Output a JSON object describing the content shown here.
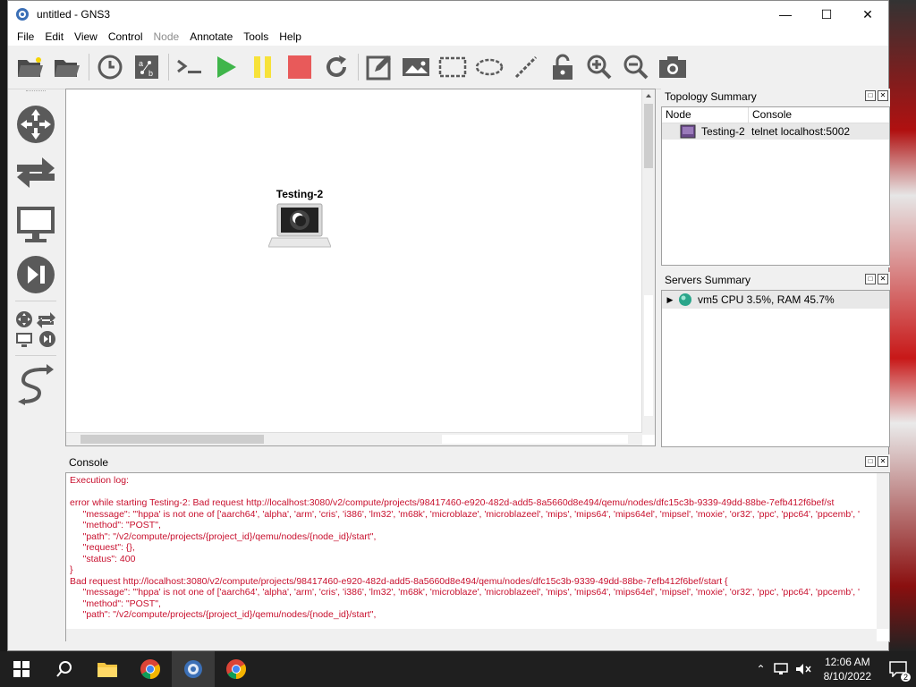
{
  "window": {
    "title": "untitled - GNS3",
    "minimize": "—",
    "maximize": "☐",
    "close": "✕"
  },
  "menu": [
    "File",
    "Edit",
    "View",
    "Control",
    "Node",
    "Annotate",
    "Tools",
    "Help"
  ],
  "menu_disabled": [
    "Node"
  ],
  "toolbar_icons": [
    "open-project-icon",
    "open-folder-icon",
    "snapshot-clock-icon",
    "show-interface-labels-icon",
    "console-all-icon",
    "start-all-icon",
    "suspend-all-icon",
    "stop-all-icon",
    "reload-all-icon",
    "add-note-icon",
    "insert-image-icon",
    "draw-rectangle-icon",
    "draw-ellipse-icon",
    "draw-line-icon",
    "lock-icon",
    "zoom-in-icon",
    "zoom-out-icon",
    "screenshot-icon"
  ],
  "left_dock_icons": [
    "routers-icon",
    "switches-icon",
    "end-devices-icon",
    "security-devices-icon",
    "all-devices-icon",
    "add-link-icon"
  ],
  "node": {
    "label": "Testing-2"
  },
  "topology": {
    "title": "Topology Summary",
    "columns": [
      "Node",
      "Console"
    ],
    "rows": [
      {
        "node": "Testing-2",
        "console": "telnet localhost:5002"
      }
    ]
  },
  "servers": {
    "title": "Servers Summary",
    "rows": [
      {
        "name": "vm5 CPU 3.5%, RAM 45.7%"
      }
    ]
  },
  "console": {
    "title": "Console",
    "lines": [
      "Execution log:",
      "",
      "error while starting Testing-2: Bad request http://localhost:3080/v2/compute/projects/98417460-e920-482d-add5-8a5660d8e494/qemu/nodes/dfc15c3b-9339-49dd-88be-7efb412f6bef/st",
      "     \"message\": \"'hppa' is not one of ['aarch64', 'alpha', 'arm', 'cris', 'i386', 'lm32', 'm68k', 'microblaze', 'microblazeel', 'mips', 'mips64', 'mips64el', 'mipsel', 'moxie', 'or32', 'ppc', 'ppc64', 'ppcemb', '",
      "     \"method\": \"POST\",",
      "     \"path\": \"/v2/compute/projects/{project_id}/qemu/nodes/{node_id}/start\",",
      "     \"request\": {},",
      "     \"status\": 400",
      "}",
      "Bad request http://localhost:3080/v2/compute/projects/98417460-e920-482d-add5-8a5660d8e494/qemu/nodes/dfc15c3b-9339-49dd-88be-7efb412f6bef/start {",
      "     \"message\": \"'hppa' is not one of ['aarch64', 'alpha', 'arm', 'cris', 'i386', 'lm32', 'm68k', 'microblaze', 'microblazeel', 'mips', 'mips64', 'mips64el', 'mipsel', 'moxie', 'or32', 'ppc', 'ppc64', 'ppcemb', '",
      "     \"method\": \"POST\",",
      "     \"path\": \"/v2/compute/projects/{project_id}/qemu/nodes/{node_id}/start\","
    ]
  },
  "taskbar": {
    "time": "12:06 AM",
    "date": "8/10/2022",
    "notifications": "2"
  },
  "colors": {
    "error_text": "#c8102e",
    "start_green": "#3fb54a",
    "suspend_yellow": "#f7e23a",
    "stop_red": "#e85a5a",
    "icon_gray": "#5a5a5a"
  }
}
